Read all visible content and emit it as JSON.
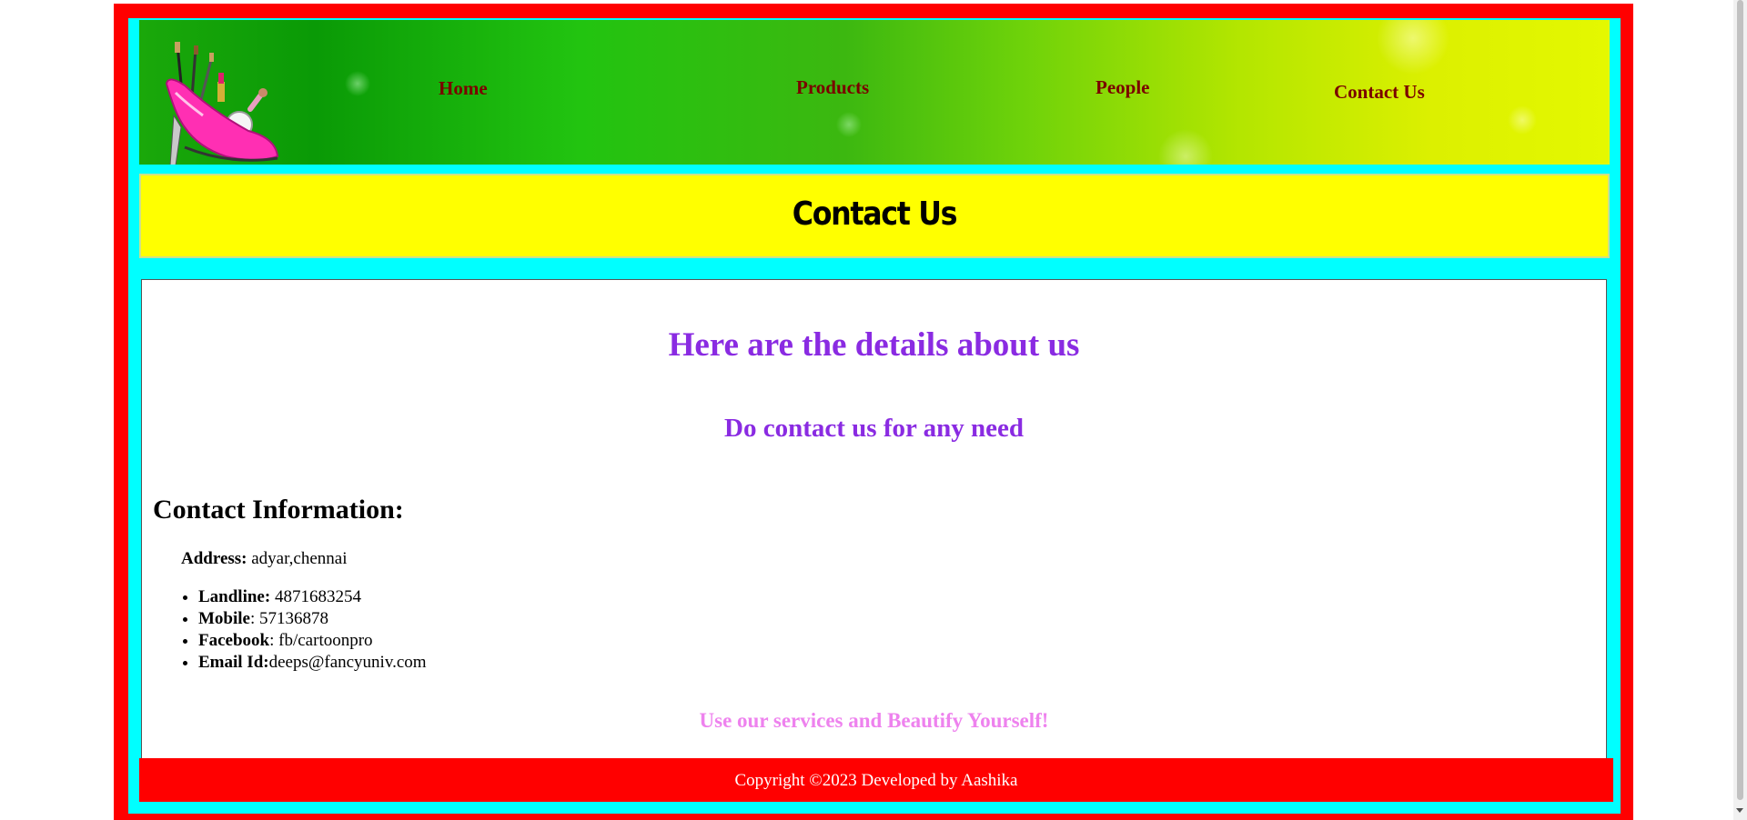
{
  "nav": {
    "home": "Home",
    "products": "Products",
    "people": "People",
    "contact": "Contact Us"
  },
  "banner": {
    "title": "Contact Us"
  },
  "content": {
    "heading": "Here are the details about us",
    "subheading": "Do contact us for any need",
    "info_heading": "Contact Information:",
    "address_label": "Address:",
    "address_value": " adyar,chennai",
    "list": [
      {
        "label": "Landline:",
        "value": " 4871683254"
      },
      {
        "label": "Mobile",
        "value": ": 57136878"
      },
      {
        "label": "Facebook",
        "value": ": fb/cartoonpro"
      },
      {
        "label": "Email Id:",
        "value": "deeps@fancyuniv.com"
      }
    ],
    "tagline": "Use our services and Beautify Yourself!"
  },
  "footer": {
    "text": "Copyright ©2023 Developed by Aashika"
  },
  "colors": {
    "outer_border": "#ff0000",
    "inner_frame": "#00ffff",
    "banner": "#ffff00",
    "nav_text": "#7a0000",
    "heading": "#8a2be2",
    "tagline": "#ee82ee",
    "footer": "#ff0000"
  },
  "icons": {
    "logo": "high-heel-makeup-logo"
  }
}
